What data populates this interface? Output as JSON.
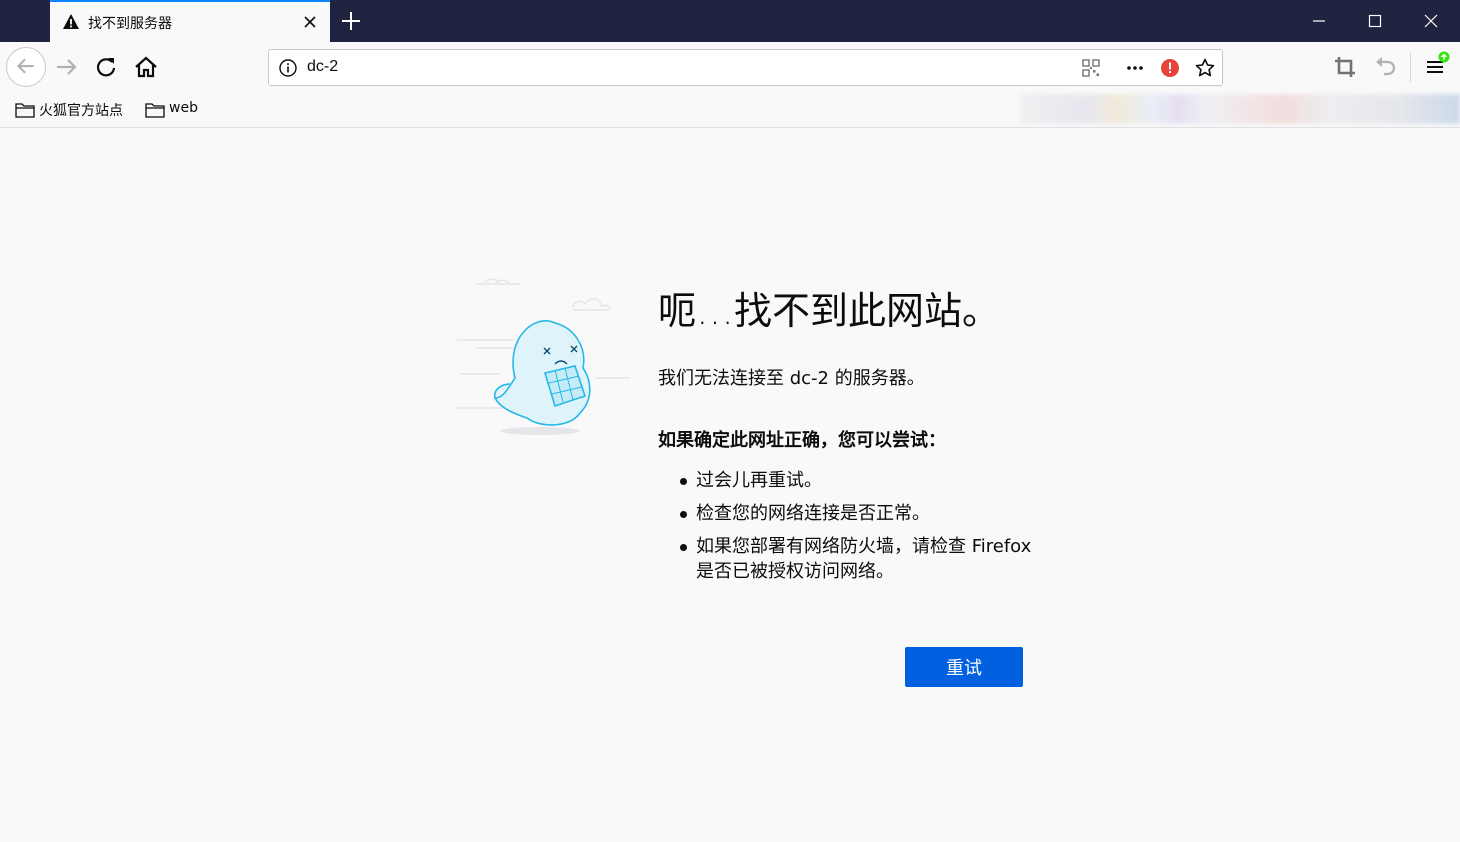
{
  "tab": {
    "title": "找不到服务器",
    "icon": "warning-icon"
  },
  "urlbar": {
    "url": "dc-2"
  },
  "bookmarks": [
    {
      "label": "火狐官方站点",
      "icon": "folder-icon"
    },
    {
      "label": "web",
      "icon": "folder-icon"
    }
  ],
  "error_page": {
    "title": "呃…找不到此网站。",
    "description": "我们无法连接至 dc-2 的服务器。",
    "suggestion_heading": "如果确定此网址正确，您可以尝试：",
    "suggestions": [
      "过会儿再重试。",
      "检查您的网络连接是否正常。",
      "如果您部署有网络防火墙，请检查 Firefox 是否已被授权访问网络。"
    ],
    "retry_label": "重试"
  },
  "colors": {
    "titlebar": "#202340",
    "accent": "#0a84ff",
    "button": "#0060df",
    "page_bg": "#f9f9fa"
  }
}
